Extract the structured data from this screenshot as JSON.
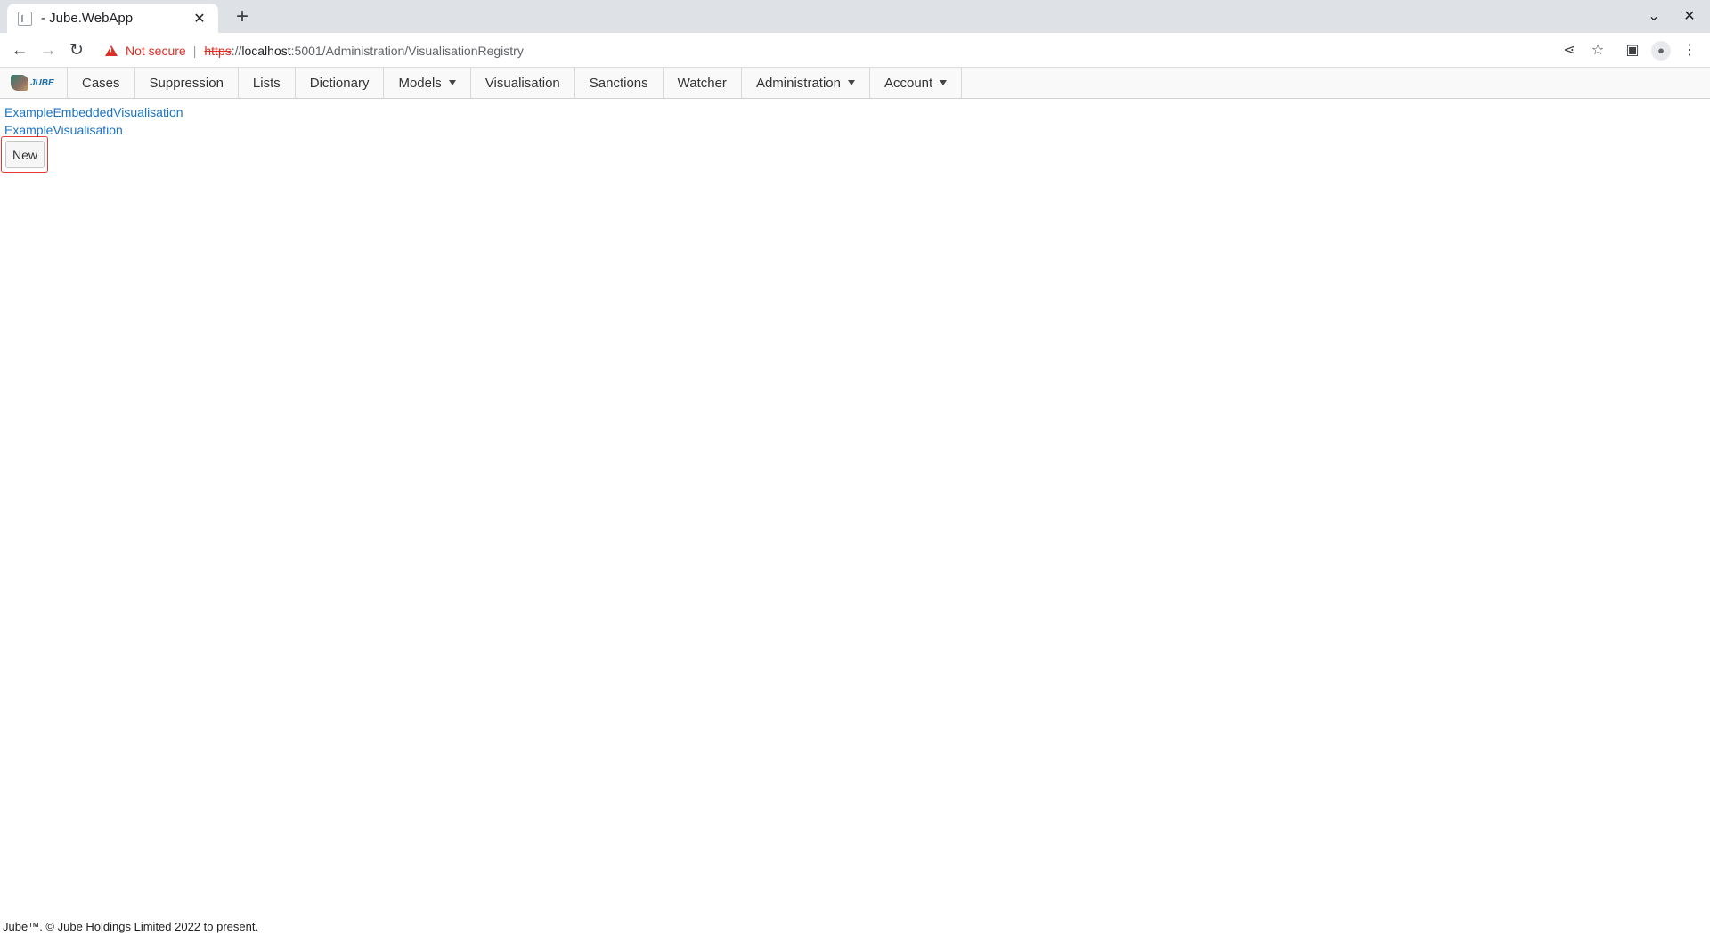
{
  "browser": {
    "tab_title": "- Jube.WebApp",
    "new_tab_symbol": "+",
    "close_symbol": "✕",
    "window_controls": [
      "⌄",
      "✕"
    ],
    "security_label": "Not secure",
    "url_scheme": "https",
    "url_sep": "://",
    "url_host": "localhost",
    "url_rest": ":5001/Administration/VisualisationRegistry"
  },
  "app": {
    "logo_text": "JUBE",
    "nav": [
      {
        "label": "Cases",
        "dropdown": false
      },
      {
        "label": "Suppression",
        "dropdown": false
      },
      {
        "label": "Lists",
        "dropdown": false
      },
      {
        "label": "Dictionary",
        "dropdown": false
      },
      {
        "label": "Models",
        "dropdown": true
      },
      {
        "label": "Visualisation",
        "dropdown": false
      },
      {
        "label": "Sanctions",
        "dropdown": false
      },
      {
        "label": "Watcher",
        "dropdown": false
      },
      {
        "label": "Administration",
        "dropdown": true
      },
      {
        "label": "Account",
        "dropdown": true
      }
    ]
  },
  "registry": {
    "items": [
      "ExampleEmbeddedVisualisation",
      "ExampleVisualisation"
    ],
    "new_button": "New"
  },
  "footer": {
    "text": "Jube™. © Jube Holdings Limited 2022 to present."
  },
  "colors": {
    "link": "#1a73c7",
    "highlight": "#e53935",
    "warning": "#d93025"
  }
}
